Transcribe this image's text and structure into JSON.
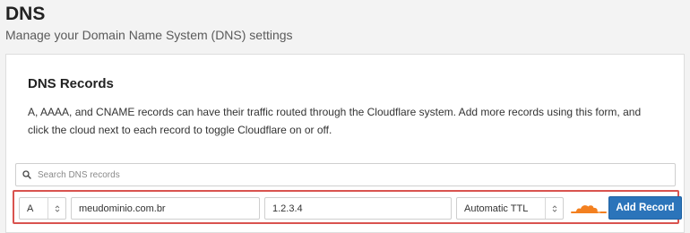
{
  "page": {
    "title": "DNS",
    "subtitle": "Manage your Domain Name System (DNS) settings"
  },
  "card": {
    "title": "DNS Records",
    "description": "A, AAAA, and CNAME records can have their traffic routed through the Cloudflare system. Add more records using this form, and click the cloud next to each record to toggle Cloudflare on or off."
  },
  "search": {
    "placeholder": "Search DNS records",
    "icon": "search-icon"
  },
  "record_form": {
    "type": "A",
    "name": "meudominio.com.br",
    "content": "1.2.3.4",
    "ttl": "Automatic TTL",
    "proxy_icon": "cloud-icon",
    "add_label": "Add Record"
  },
  "colors": {
    "accent": "#2b74ba",
    "highlight_border": "#d9534f",
    "cloud_orange": "#f38020"
  }
}
